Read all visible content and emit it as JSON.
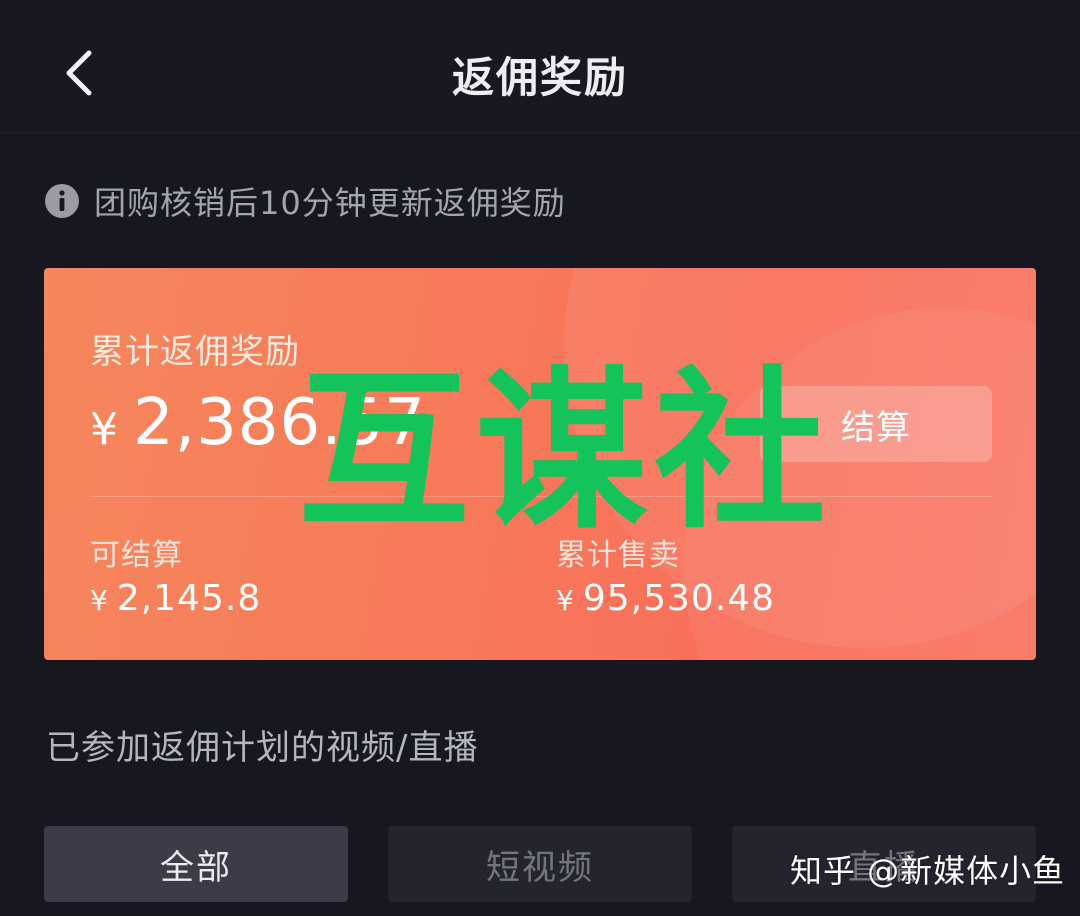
{
  "header": {
    "title": "返佣奖励"
  },
  "notice": {
    "text": "团购核销后10分钟更新返佣奖励"
  },
  "card": {
    "total_label": "累计返佣奖励",
    "currency": "¥",
    "total_amount": "2,386.57",
    "settle_label": "结算",
    "stats": [
      {
        "label": "可结算",
        "currency": "¥",
        "value": "2,145.8"
      },
      {
        "label": "累计售卖",
        "currency": "¥",
        "value": "95,530.48"
      }
    ],
    "gradient_colors": [
      "#f5875c",
      "#f86f5a"
    ]
  },
  "watermark": {
    "text": "互谋社",
    "color": "#14c359"
  },
  "section": {
    "title": "已参加返佣计划的视频/直播"
  },
  "tabs": [
    {
      "label": "全部",
      "active": true
    },
    {
      "label": "短视频",
      "active": false
    },
    {
      "label": "直播",
      "active": false
    }
  ],
  "zhihu_watermark": {
    "text": "知乎 @新媒体小鱼"
  }
}
